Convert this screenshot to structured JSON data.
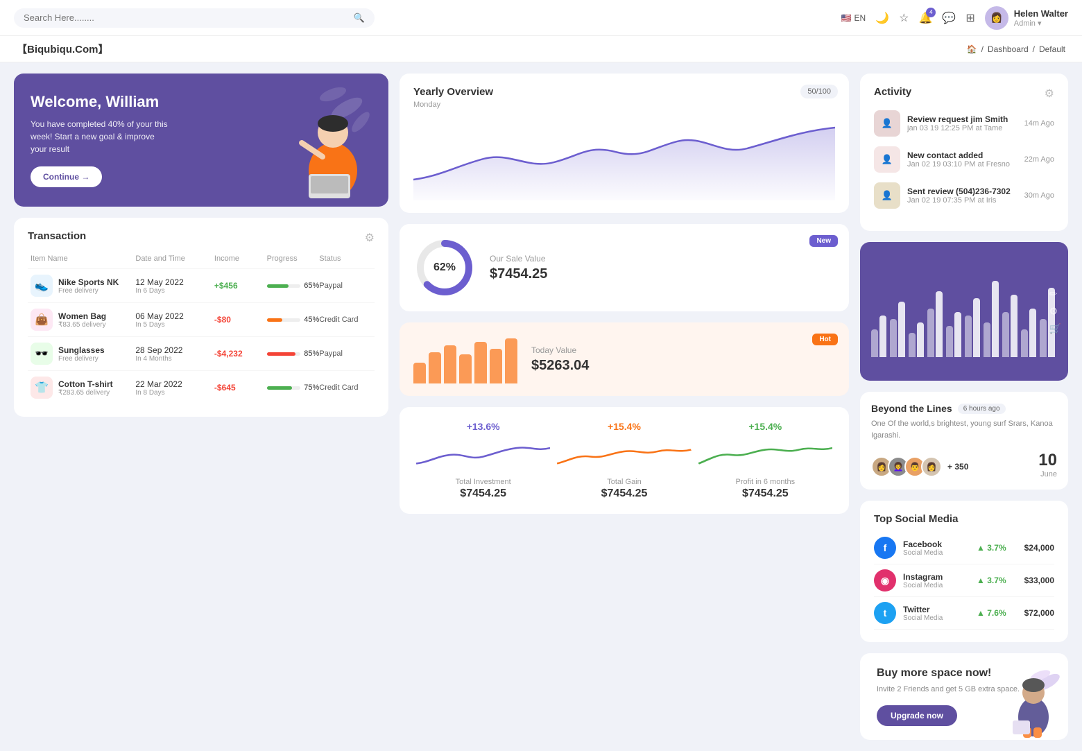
{
  "topnav": {
    "search_placeholder": "Search Here........",
    "lang": "EN",
    "user": {
      "name": "Helen Walter",
      "role": "Admin"
    },
    "notification_count": "4"
  },
  "breadcrumb": {
    "brand": "【Biqubiqu.Com】",
    "home": "Home",
    "dashboard": "Dashboard",
    "current": "Default"
  },
  "welcome": {
    "title": "Welcome, William",
    "subtitle": "You have completed 40% of your this week! Start a new goal & improve your result",
    "btn": "Continue →"
  },
  "yearly_overview": {
    "title": "Yearly Overview",
    "day": "Monday",
    "badge": "50/100"
  },
  "activity": {
    "title": "Activity",
    "items": [
      {
        "title": "Review request jim Smith",
        "sub": "jan 03 19 12:25 PM at Tame",
        "time": "14m Ago",
        "color": "#e8d5d5"
      },
      {
        "title": "New contact added",
        "sub": "Jan 02 19 03:10 PM at Fresno",
        "time": "22m Ago",
        "color": "#f5e6e6"
      },
      {
        "title": "Sent review (504)236-7302",
        "sub": "Jan 02 19 07:35 PM at Iris",
        "time": "30m Ago",
        "color": "#e8dfc8"
      }
    ]
  },
  "transaction": {
    "title": "Transaction",
    "cols": [
      "Item Name",
      "Date and Time",
      "Income",
      "Progress",
      "Status"
    ],
    "rows": [
      {
        "icon": "👟",
        "icon_bg": "#e8f4fd",
        "name": "Nike Sports NK",
        "sub": "Free delivery",
        "date": "12 May 2022",
        "days": "In 6 Days",
        "income": "+$456",
        "income_type": "pos",
        "progress": 65,
        "progress_color": "#4caf50",
        "status": "Paypal"
      },
      {
        "icon": "👜",
        "icon_bg": "#fde8f4",
        "name": "Women Bag",
        "sub": "₹83.65 delivery",
        "date": "06 May 2022",
        "days": "In 5 Days",
        "income": "-$80",
        "income_type": "neg",
        "progress": 45,
        "progress_color": "#f97316",
        "status": "Credit Card"
      },
      {
        "icon": "🕶️",
        "icon_bg": "#e8fde8",
        "name": "Sunglasses",
        "sub": "Free delivery",
        "date": "28 Sep 2022",
        "days": "In 4 Months",
        "income": "-$4,232",
        "income_type": "neg",
        "progress": 85,
        "progress_color": "#f44336",
        "status": "Paypal"
      },
      {
        "icon": "👕",
        "icon_bg": "#fde8e8",
        "name": "Cotton T-shirt",
        "sub": "₹283.65 delivery",
        "date": "22 Mar 2022",
        "days": "In 8 Days",
        "income": "-$645",
        "income_type": "neg",
        "progress": 75,
        "progress_color": "#4caf50",
        "status": "Credit Card"
      }
    ]
  },
  "sale_value": {
    "pct": "62%",
    "subtitle": "Our Sale Value",
    "value": "$7454.25",
    "badge": "New"
  },
  "today_value": {
    "subtitle": "Today Value",
    "value": "$5263.04",
    "badge": "Hot",
    "bars": [
      30,
      45,
      55,
      42,
      60,
      50,
      65
    ]
  },
  "bar_chart": {
    "groups": [
      {
        "a": 40,
        "b": 60
      },
      {
        "a": 55,
        "b": 80
      },
      {
        "a": 35,
        "b": 50
      },
      {
        "a": 70,
        "b": 95
      },
      {
        "a": 45,
        "b": 65
      },
      {
        "a": 60,
        "b": 85
      },
      {
        "a": 50,
        "b": 110
      },
      {
        "a": 65,
        "b": 90
      },
      {
        "a": 40,
        "b": 70
      },
      {
        "a": 55,
        "b": 100
      }
    ]
  },
  "beyond": {
    "title": "Beyond the Lines",
    "time": "6 hours ago",
    "desc": "One Of the world,s brightest, young surf Srars, Kanoa Igarashi.",
    "plus": "+ 350",
    "date_num": "10",
    "date_month": "June"
  },
  "stats": [
    {
      "pct": "+13.6%",
      "pct_color": "#6c5ecf",
      "label": "Total Investment",
      "value": "$7454.25",
      "color": "#6c5ecf"
    },
    {
      "pct": "+15.4%",
      "pct_color": "#f97316",
      "label": "Total Gain",
      "value": "$7454.25",
      "color": "#f97316"
    },
    {
      "pct": "+15.4%",
      "pct_color": "#4caf50",
      "label": "Profit in 6 months",
      "value": "$7454.25",
      "color": "#4caf50"
    }
  ],
  "social_media": {
    "title": "Top Social Media",
    "items": [
      {
        "icon": "f",
        "bg": "#1877f2",
        "name": "Facebook",
        "type": "Social Media",
        "pct": "3.7%",
        "amt": "$24,000"
      },
      {
        "icon": "◉",
        "bg": "#e1306c",
        "name": "Instagram",
        "type": "Social Media",
        "pct": "3.7%",
        "amt": "$33,000"
      },
      {
        "icon": "t",
        "bg": "#1da1f2",
        "name": "Twitter",
        "type": "Social Media",
        "pct": "7.6%",
        "amt": "$72,000"
      }
    ]
  },
  "upgrade": {
    "title": "Buy more space now!",
    "desc": "Invite 2 Friends and get 5 GB extra space.",
    "btn": "Upgrade now"
  }
}
